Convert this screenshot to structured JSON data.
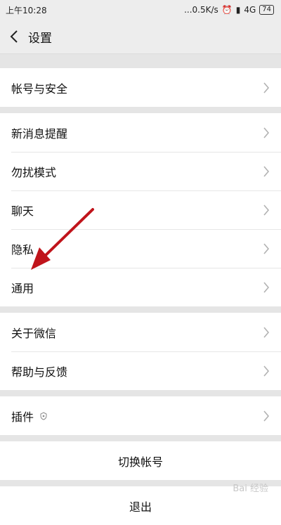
{
  "status": {
    "time": "上午10:28",
    "speed": "...0.5K/s",
    "network": "4G",
    "battery": "74"
  },
  "header": {
    "title": "设置"
  },
  "groups": [
    {
      "items": [
        {
          "label": "帐号与安全"
        }
      ]
    },
    {
      "items": [
        {
          "label": "新消息提醒"
        },
        {
          "label": "勿扰模式"
        },
        {
          "label": "聊天"
        },
        {
          "label": "隐私"
        },
        {
          "label": "通用"
        }
      ]
    },
    {
      "items": [
        {
          "label": "关于微信"
        },
        {
          "label": "帮助与反馈"
        }
      ]
    },
    {
      "items": [
        {
          "label": "插件"
        }
      ]
    }
  ],
  "actions": {
    "switch_account": "切换帐号",
    "logout": "退出"
  },
  "watermark": "Bai 经验",
  "annotation": {
    "color": "#c0141b",
    "icon": "red-arrow-pointing-to-general"
  }
}
